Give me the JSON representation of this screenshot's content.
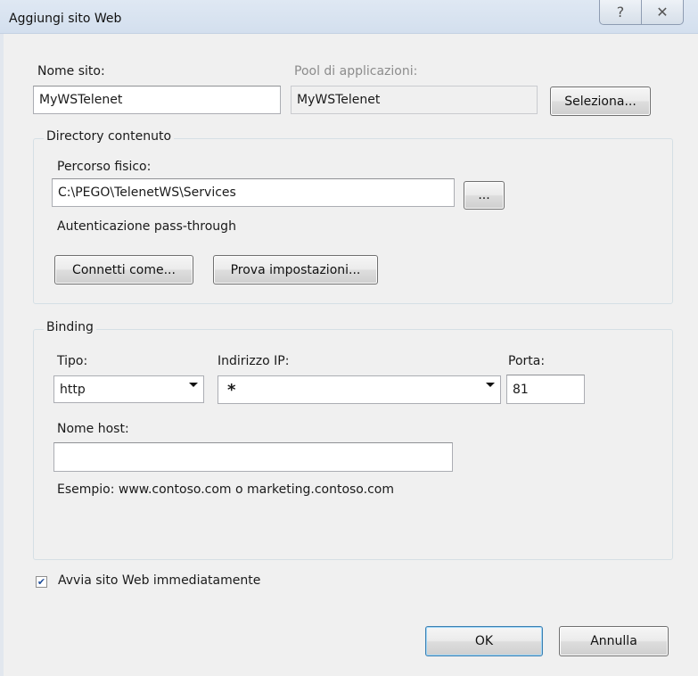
{
  "dialog": {
    "title": "Aggiungi sito Web",
    "help_icon": "help-icon",
    "close_icon": "close-icon"
  },
  "site": {
    "name_label": "Nome sito:",
    "name_value": "MyWSTelenet",
    "pool_label": "Pool di applicazioni:",
    "pool_value": "MyWSTelenet",
    "select_button": "Seleziona..."
  },
  "content_directory": {
    "group_title": "Directory contenuto",
    "path_label": "Percorso fisico:",
    "path_value": "C:\\PEGO\\TelenetWS\\Services",
    "browse_button": "...",
    "auth_text": "Autenticazione pass-through",
    "connect_as_button": "Connetti come...",
    "test_settings_button": "Prova impostazioni..."
  },
  "binding": {
    "group_title": "Binding",
    "type_label": "Tipo:",
    "type_value": "http",
    "ip_label": "Indirizzo IP:",
    "ip_value": "*",
    "port_label": "Porta:",
    "port_value": "81",
    "host_label": "Nome host:",
    "host_value": "",
    "example_text": "Esempio: www.contoso.com o marketing.contoso.com"
  },
  "start_immediately": {
    "label": "Avvia sito Web immediatamente",
    "checked": true
  },
  "footer": {
    "ok_button": "OK",
    "cancel_button": "Annulla"
  }
}
